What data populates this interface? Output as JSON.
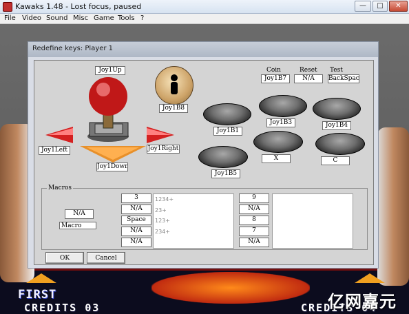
{
  "window": {
    "title": "Kawaks 1.48 - Lost focus, paused",
    "min_glyph": "—",
    "max_glyph": "□",
    "close_glyph": "✕"
  },
  "menu": [
    "File",
    "Video",
    "Sound",
    "Misc",
    "Game",
    "Tools",
    "?"
  ],
  "game": {
    "first": "FIRST",
    "credits_left": "CREDITS 03",
    "credits_right": "CREDITS 04"
  },
  "watermark": "亿网嘉元",
  "dialog": {
    "title": "Redefine keys: Player 1",
    "up": "Joy1Up",
    "left": "Joy1Left",
    "right": "Joy1Right",
    "down": "Joy1Down",
    "start": "Joy1B8",
    "coin_label": "Coin",
    "reset_label": "Reset",
    "test_label": "Test",
    "coin_key": "Joy1B7",
    "reset_key": "N/A",
    "test_key": "BackSpace",
    "btn_a": "Joy1B1",
    "btn_b": "Joy1B3",
    "btn_c": "Joy1B4",
    "btn_d": "Joy1B5",
    "btn_e": "X",
    "btn_f": "C",
    "macros_label": "Macros",
    "macro_key": "N/A",
    "macro_label": "Macro",
    "macro_left_keys": [
      "3",
      "N/A",
      "Space",
      "N/A",
      "N/A"
    ],
    "macro_left_list": [
      "1234+",
      "23+",
      "123+",
      "234+"
    ],
    "macro_right_keys": [
      "9",
      "N/A",
      "8",
      "7",
      "N/A"
    ],
    "ok_label": "OK",
    "cancel_label": "Cancel"
  },
  "colors": {
    "accent_red": "#d42020",
    "dialog_bg": "#d9dde6",
    "panel_bg": "#d4d4d4"
  }
}
